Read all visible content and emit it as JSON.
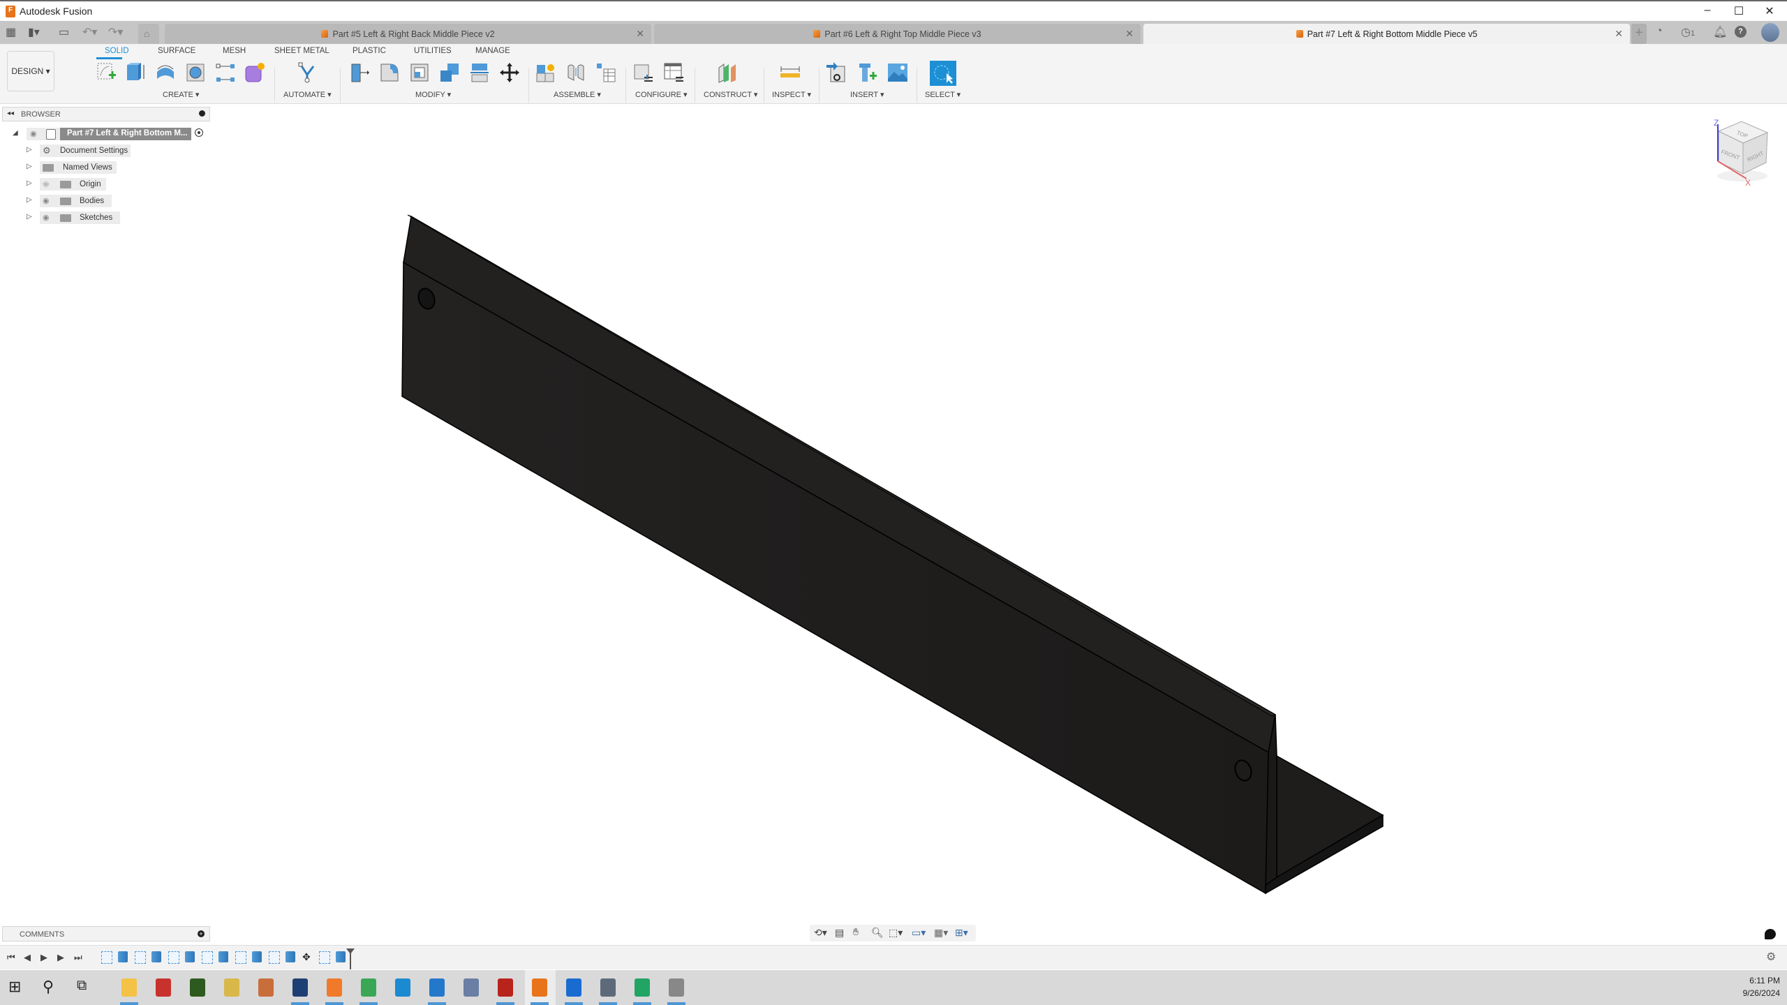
{
  "window": {
    "app_title": "Autodesk Fusion",
    "controls": {
      "minimize": "–",
      "maximize": "☐",
      "close": "✕"
    }
  },
  "quick_access": {
    "icons": [
      "grid-menu-icon",
      "file-icon",
      "save-icon",
      "undo-icon",
      "redo-icon",
      "home-icon"
    ]
  },
  "doc_tabs": [
    {
      "label": "Part #5 Left & Right Back Middle Piece v2",
      "active": false
    },
    {
      "label": "Part #6 Left & Right Top Middle Piece v3",
      "active": false
    },
    {
      "label": "Part #7 Left & Right Bottom Middle Piece v5",
      "active": true
    }
  ],
  "header_right": {
    "job_count": "1",
    "icons": [
      "new-tab-icon",
      "sync-icon",
      "job-status-icon",
      "notification-icon",
      "help-icon",
      "user-avatar"
    ]
  },
  "toolbar": {
    "workspace": "DESIGN ▾",
    "tabs": [
      "SOLID",
      "SURFACE",
      "MESH",
      "SHEET METAL",
      "PLASTIC",
      "UTILITIES",
      "MANAGE"
    ],
    "active_tab": "SOLID",
    "groups": [
      {
        "label": "CREATE ▾",
        "tools": [
          "create-sketch",
          "extrude",
          "revolve",
          "hole",
          "pattern",
          "create-form"
        ]
      },
      {
        "label": "AUTOMATE ▾",
        "tools": [
          "automate"
        ]
      },
      {
        "label": "MODIFY ▾",
        "tools": [
          "press-pull",
          "fillet",
          "shell",
          "combine",
          "split-body",
          "move-copy"
        ]
      },
      {
        "label": "ASSEMBLE ▾",
        "tools": [
          "new-component",
          "joint",
          "bill-of-materials"
        ]
      },
      {
        "label": "CONFIGURE ▾",
        "tools": [
          "configure-model",
          "configuration-table"
        ]
      },
      {
        "label": "CONSTRUCT ▾",
        "tools": [
          "offset-plane"
        ]
      },
      {
        "label": "INSPECT ▾",
        "tools": [
          "measure"
        ]
      },
      {
        "label": "INSERT ▾",
        "tools": [
          "insert-derive",
          "insert-mcmaster",
          "insert-canvas"
        ]
      },
      {
        "label": "SELECT ▾",
        "tools": [
          "select"
        ]
      }
    ]
  },
  "browser": {
    "title": "BROWSER",
    "root": "Part #7 Left & Right Bottom M...",
    "items": [
      {
        "label": "Document Settings",
        "icon": "gear",
        "visible": null
      },
      {
        "label": "Named Views",
        "icon": "folder",
        "visible": null
      },
      {
        "label": "Origin",
        "icon": "folder",
        "visible": false
      },
      {
        "label": "Bodies",
        "icon": "folder",
        "visible": true
      },
      {
        "label": "Sketches",
        "icon": "folder",
        "visible": true
      }
    ]
  },
  "viewcube": {
    "top": "TOP",
    "front": "FRONT",
    "right": "RIGHT",
    "axis_z": "Z",
    "axis_x": "X"
  },
  "comments": {
    "title": "COMMENTS"
  },
  "timeline": {
    "controls": [
      "go-to-start",
      "step-back",
      "play",
      "step-forward",
      "go-to-end"
    ],
    "features": [
      "sketch",
      "extrude",
      "sketch",
      "extrude",
      "sketch",
      "extrude",
      "sketch",
      "extrude",
      "sketch",
      "extrude",
      "sketch",
      "extrude",
      "move",
      "sketch",
      "extrude"
    ]
  },
  "nav_bar": {
    "tools": [
      "orbit",
      "look-at",
      "pan",
      "zoom",
      "fit",
      "display-settings",
      "grid-snaps",
      "viewports"
    ]
  },
  "taskbar": {
    "apps": [
      "start",
      "search",
      "task-view",
      "file-explorer",
      "es",
      "ss",
      "app-blue",
      "app-colorful",
      "virtualbox",
      "firefox",
      "chrome",
      "edge",
      "vscode",
      "network",
      "filezilla",
      "fusion",
      "c-app",
      "calculator",
      "sheets",
      "app-gray"
    ],
    "time": "6:11 PM",
    "date": "9/26/2024"
  }
}
